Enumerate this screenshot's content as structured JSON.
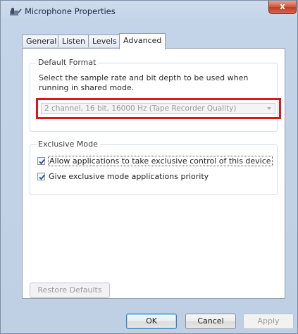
{
  "window": {
    "title": "Microphone Properties",
    "close_label": "x"
  },
  "tabs": [
    {
      "label": "General"
    },
    {
      "label": "Listen"
    },
    {
      "label": "Levels"
    },
    {
      "label": "Advanced",
      "active": true
    }
  ],
  "default_format": {
    "legend": "Default Format",
    "description": "Select the sample rate and bit depth to be used when running in shared mode.",
    "selected_value": "2 channel, 16 bit, 16000 Hz (Tape Recorder Quality)"
  },
  "exclusive_mode": {
    "legend": "Exclusive Mode",
    "options": [
      {
        "label": "Allow applications to take exclusive control of this device",
        "checked": true
      },
      {
        "label": "Give exclusive mode applications priority",
        "checked": true
      }
    ]
  },
  "buttons": {
    "restore_defaults": "Restore Defaults",
    "ok": "OK",
    "cancel": "Cancel",
    "apply": "Apply"
  },
  "colors": {
    "highlight": "#e0141c",
    "close": "#c03b22"
  }
}
